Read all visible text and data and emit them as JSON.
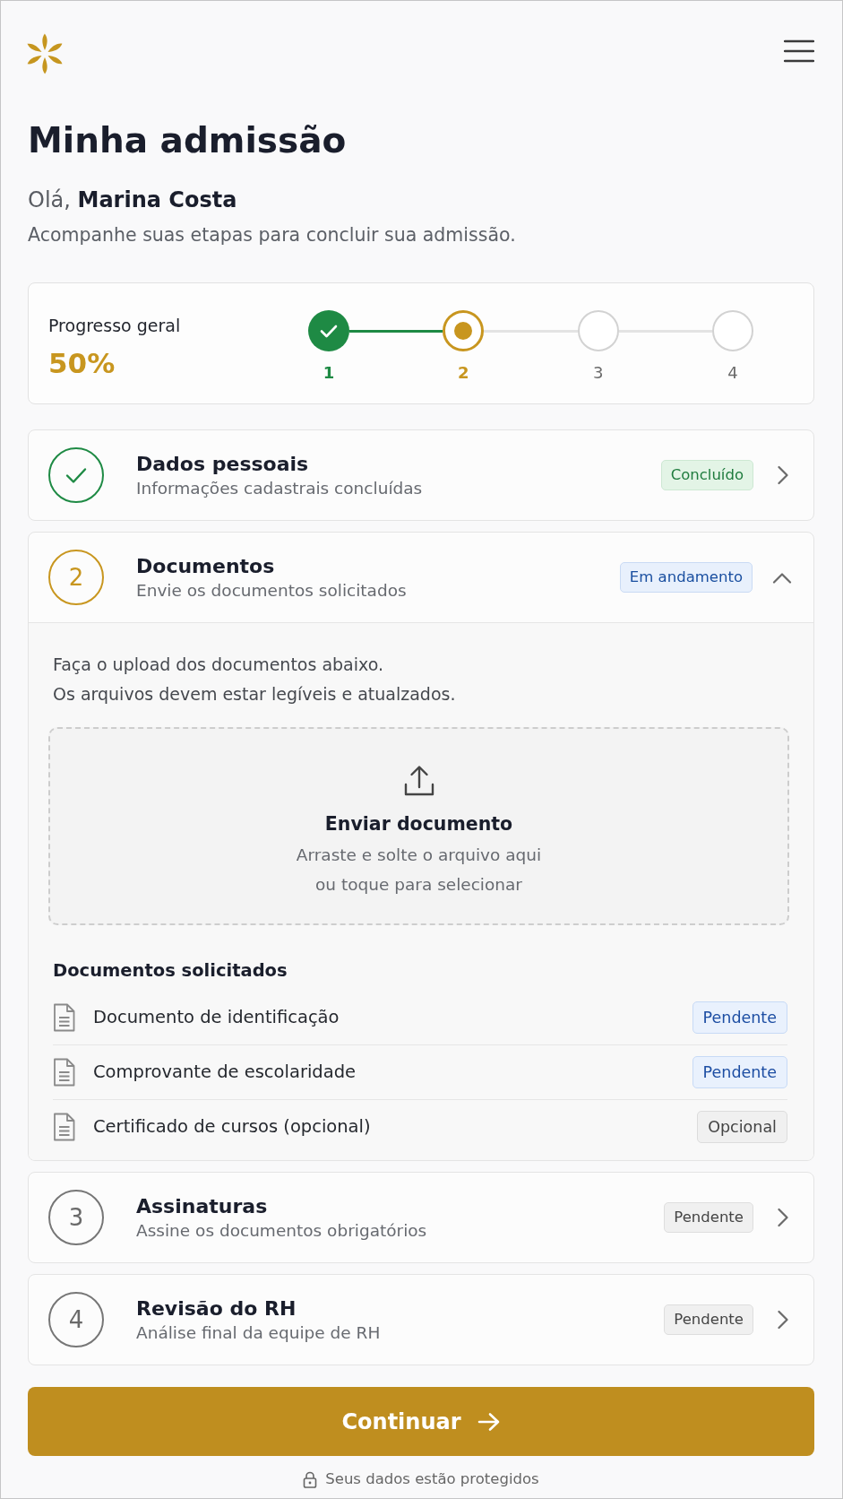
{
  "page": {
    "title": "Minha admissão",
    "greeting": "Olá, **Marina Costa**",
    "subtitle": "Acompanhe suas etapas para concluir sua admissão."
  },
  "progress": {
    "label": "Progresso geral",
    "value": "50%",
    "steps": [
      {
        "label": "1",
        "completed": true,
        "current": false
      },
      {
        "label": "2",
        "completed": false,
        "current": true
      },
      {
        "label": "3",
        "completed": false,
        "current": false
      },
      {
        "label": "4",
        "completed": false,
        "current": false
      }
    ]
  },
  "cards": [
    {
      "title": "Dados pessoais",
      "description": "Informações cadastrais concluídas",
      "badge": "Concluído",
      "completed": true,
      "current": false,
      "expanded": false
    },
    {
      "number": "2",
      "title": "Documentos",
      "description": "Envie os documentos solicitados",
      "badge": "Em andamento",
      "completed": false,
      "current": true,
      "expanded": true,
      "body": {
        "instructions": [
          "Faça o upload dos documentos abaixo.",
          "Os arquivos devem estar legíveis e atualzados."
        ],
        "upload": {
          "title": "Enviar documento",
          "hint": [
            "Arraste e solte o arquivo aqui",
            "ou toque para selecionar"
          ]
        },
        "documents_heading": "Documentos solicitados",
        "documents": [
          {
            "name": "Documento de identificação",
            "badge": "Pendente",
            "required": true
          },
          {
            "name": "Comprovante de escolaridade",
            "badge": "Pendente",
            "required": true
          },
          {
            "name": "Certificado de cursos (opcional)",
            "badge": "Opcional",
            "required": false
          }
        ]
      }
    },
    {
      "number": "3",
      "title": "Assinaturas",
      "description": "Assine os documentos obrigatórios",
      "badge": "Pendente",
      "completed": false,
      "current": false,
      "expanded": false
    },
    {
      "number": "4",
      "title": "Revisão do RH",
      "description": "Análise final da equipe de RH",
      "badge": "Pendente",
      "completed": false,
      "current": false,
      "expanded": false
    }
  ],
  "continue_button": {
    "label": "Continuar"
  },
  "footer": {
    "note": "Seus dados estão protegidos"
  }
}
